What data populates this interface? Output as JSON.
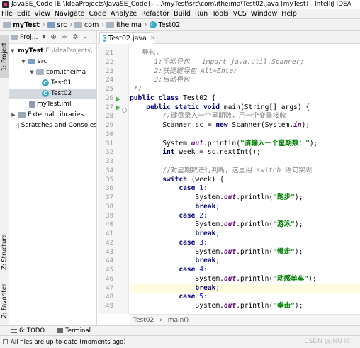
{
  "window": {
    "title": "JavaSE_Code [E:\\IdeaProjects\\JavaSE_Code] - ...\\myTest\\src\\com\\itheima\\Test02.java [myTest] - IntelliJ IDEA"
  },
  "menu": [
    "File",
    "Edit",
    "View",
    "Navigate",
    "Code",
    "Analyze",
    "Refactor",
    "Build",
    "Run",
    "Tools",
    "VCS",
    "Window",
    "Help"
  ],
  "breadcrumb": [
    "myTest",
    "src",
    "com",
    "itheima",
    "Test02"
  ],
  "sidebar_left": {
    "project_tab": "1: Project",
    "structure_tab": "Z: Structure",
    "favorites_tab": "2: Favorites"
  },
  "project_panel": {
    "title": "Proj...",
    "tree": [
      {
        "label": "myTest",
        "extra": "E:\\IdeaProjects\\...",
        "arrow": "▼"
      },
      {
        "label": "src",
        "arrow": "▼"
      },
      {
        "label": "com.itheima",
        "arrow": "▼"
      },
      {
        "label": "Test01",
        "arrow": ""
      },
      {
        "label": "Test02",
        "arrow": "",
        "selected": true
      },
      {
        "label": "myTest.iml",
        "arrow": ""
      },
      {
        "label": "External Libraries",
        "arrow": "▶"
      },
      {
        "label": "Scratches and Consoles",
        "arrow": ""
      }
    ]
  },
  "editor": {
    "tab_label": "Test02.java",
    "line_numbers": [
      "21",
      "22",
      "23",
      "24",
      "25",
      "26",
      "27",
      "28",
      "29",
      "30",
      "31",
      "32",
      "33",
      "34",
      "35",
      "36",
      "37",
      "38",
      "39",
      "40",
      "41",
      "42",
      "43",
      "44",
      "45",
      "46",
      "47",
      "48",
      "49"
    ],
    "lines": {
      "l21": "导包，",
      "l22a": "1:手动导包   ",
      "l22b": "import java.util.Scanner;",
      "l23a": "2:快捷键导包 ",
      "l23b": "Alt+Enter",
      "l24": "3:自动导包",
      "l25": "*/",
      "l26a": "public class",
      "l26b": " Test02 {",
      "l27a": "public static void",
      "l27b": " main(String[] args) {",
      "l28": "//键盘录入一个星期数，用一个变量接收",
      "l29a": "Scanner sc = ",
      "l29b": "new",
      "l29c": " Scanner(System.",
      "l29d": "in",
      "l29e": ");",
      "l31a": "System.",
      "l31b": "out",
      "l31c": ".println(",
      "l31d": "\"请输入一个星期数：\"",
      "l31e": ");",
      "l32a": "int",
      "l32b": " week = sc.nextInt();",
      "l34a": "//对星期数进行判断，这里用 ",
      "l34b": "switch",
      "l34c": " 语句实现",
      "l35a": "switch",
      "l35b": " (week) {",
      "case_kw": "case",
      "break_kw": "break",
      "case1": " 1:",
      "case2": " 2:",
      "case3": " 3:",
      "case4": " 4:",
      "case5": " 5:",
      "println_a": "System.",
      "println_out": "out",
      "println_c": ".println(",
      "println_end": ");",
      "semi": ";",
      "s1": "\"跑步\"",
      "s2": "\"游泳\"",
      "s3": "\"慢走\"",
      "s4": "\"动感单车\"",
      "s5": "\"拳击\""
    }
  },
  "code_breadcrumb": [
    "Test02",
    "main()"
  ],
  "bottom_tools": [
    "6: TODO",
    "Terminal"
  ],
  "status": {
    "message": "All files are up-to-date (moments ago)"
  },
  "watermark": "CSDN @JNU IE"
}
